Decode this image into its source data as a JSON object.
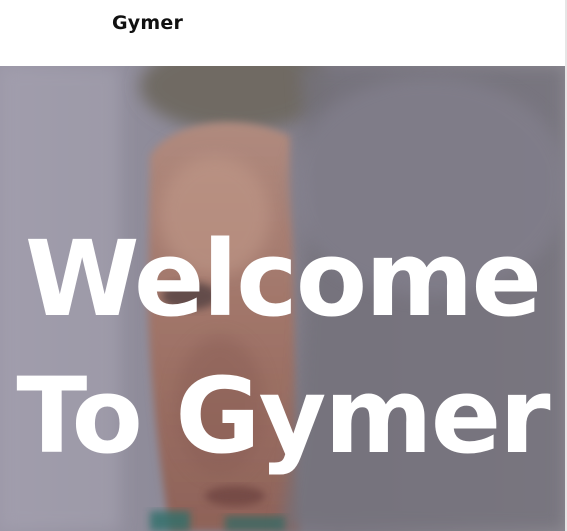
{
  "navbar": {
    "brand": "Gymer"
  },
  "hero": {
    "title_line1": "Welcome",
    "title_line2": "To Gymer",
    "background_image": "blurred-portrait-photo",
    "text_color": "#ffffff"
  }
}
